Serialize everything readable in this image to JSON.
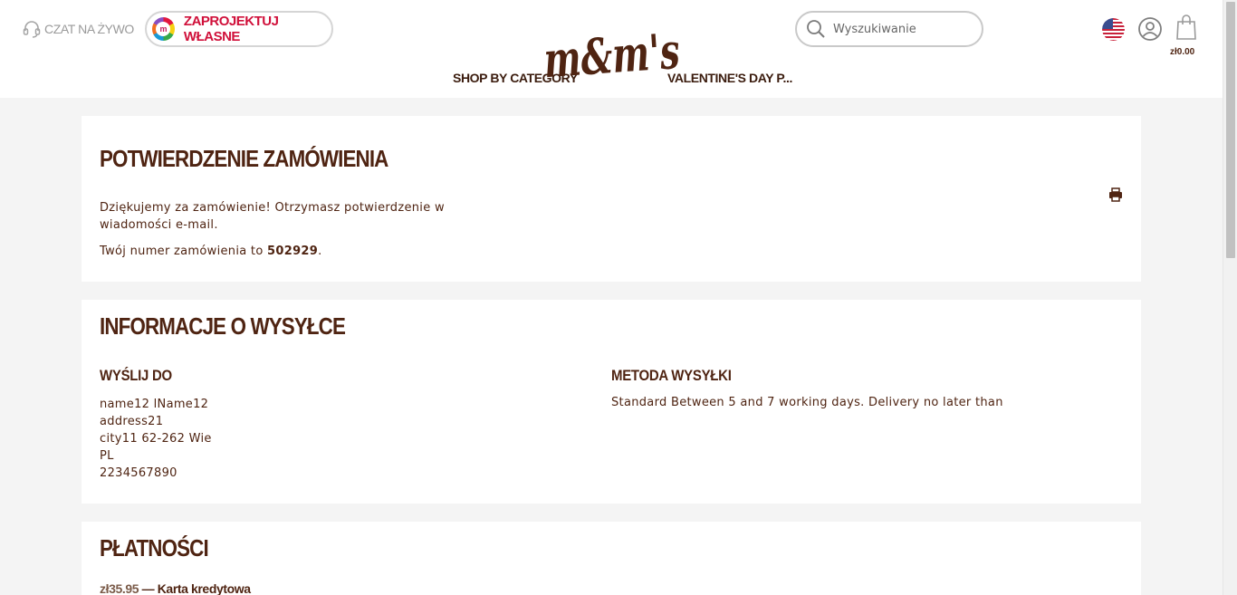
{
  "header": {
    "chat_label": "CZAT NA ŻYWO",
    "design_label": "ZAPROJEKTUJ WŁASNE",
    "design_logo_letter": "m",
    "logo_text": "m&m's",
    "nav_left": "SHOP BY CATEGORY",
    "nav_right": "VALENTINE'S DAY P...",
    "search_placeholder": "Wyszukiwanie",
    "cart_total": "zł0.00"
  },
  "confirmation": {
    "title": "POTWIERDZENIE ZAMÓWIENIA",
    "thanks_text": "Dziękujemy za zamówienie! Otrzymasz potwierdzenie w wiadomości e-mail.",
    "order_prefix": "Twój numer zamówienia to ",
    "order_number": "502929",
    "order_suffix": "."
  },
  "shipping": {
    "title": "INFORMACJE O WYSYŁCE",
    "ship_to_heading": "WYŚLIJ DO",
    "address": {
      "name": "name12 lName12",
      "street": "address21",
      "city": "city11 62-262 Wie",
      "country": "PL",
      "phone": "2234567890"
    },
    "method_heading": "METODA WYSYŁKI",
    "method_text": "Standard Between 5 and 7 working days. Delivery no later than"
  },
  "payment": {
    "title": "PŁATNOŚCI",
    "amount": "zł35.95",
    "separator": " — ",
    "method": "Karta kredytowa"
  },
  "colors": {
    "brand_brown": "#4f2412",
    "accent_red": "#d0103a",
    "page_bg": "#f4f4f4"
  }
}
